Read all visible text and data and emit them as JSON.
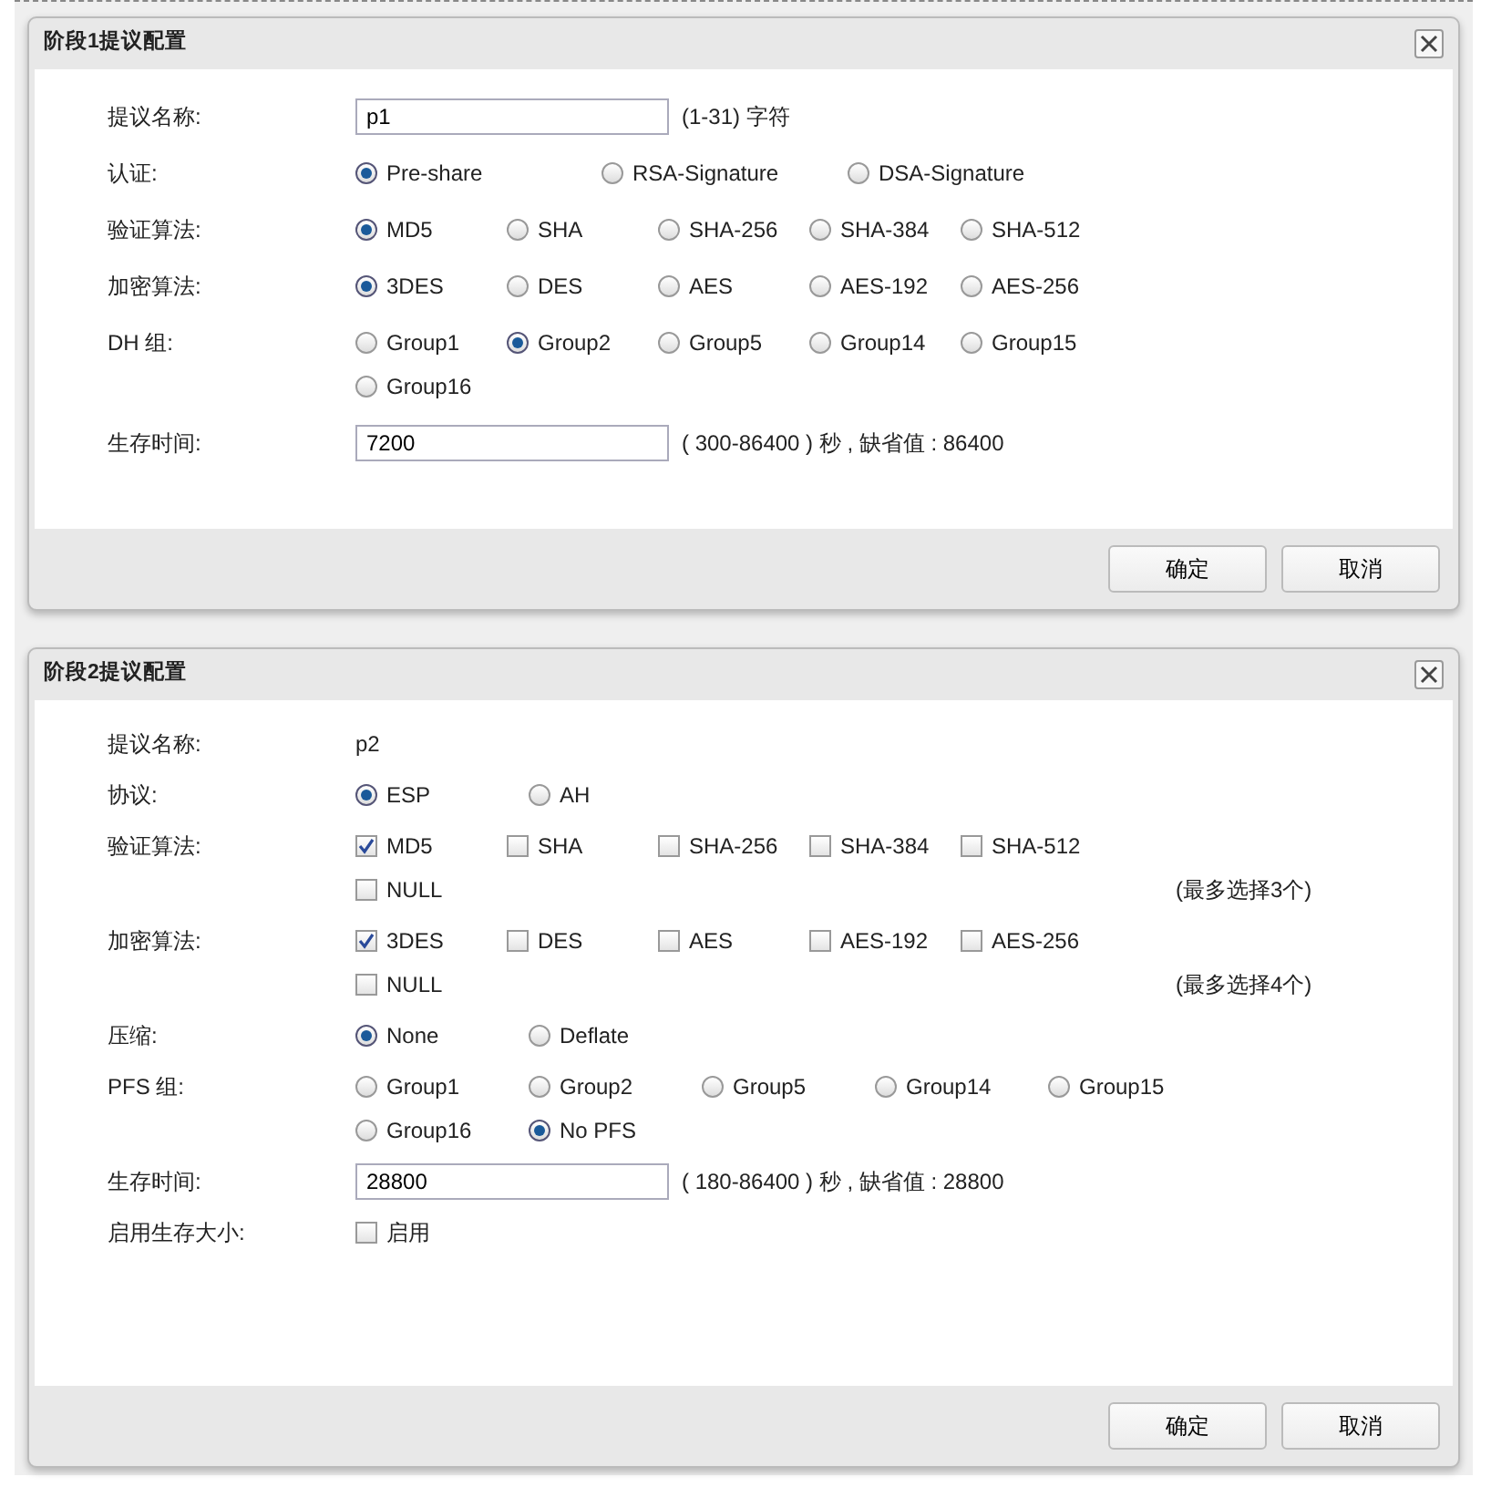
{
  "dialogs": [
    {
      "title": "阶段1提议配置",
      "rows": [
        {
          "kind": "input",
          "label": "提议名称:",
          "value": "p1",
          "hint": "(1-31) 字符"
        },
        {
          "kind": "radio",
          "label": "认证:",
          "options": [
            {
              "label": "Pre-share",
              "selected": true
            },
            {
              "label": "RSA-Signature",
              "selected": false
            },
            {
              "label": "DSA-Signature",
              "selected": false
            }
          ]
        },
        {
          "kind": "radio",
          "label": "验证算法:",
          "options": [
            {
              "label": "MD5",
              "selected": true
            },
            {
              "label": "SHA",
              "selected": false
            },
            {
              "label": "SHA-256",
              "selected": false
            },
            {
              "label": "SHA-384",
              "selected": false
            },
            {
              "label": "SHA-512",
              "selected": false
            }
          ]
        },
        {
          "kind": "radio",
          "label": "加密算法:",
          "options": [
            {
              "label": "3DES",
              "selected": true
            },
            {
              "label": "DES",
              "selected": false
            },
            {
              "label": "AES",
              "selected": false
            },
            {
              "label": "AES-192",
              "selected": false
            },
            {
              "label": "AES-256",
              "selected": false
            }
          ]
        },
        {
          "kind": "radio",
          "label": "DH 组:",
          "options": [
            {
              "label": "Group1",
              "selected": false
            },
            {
              "label": "Group2",
              "selected": true
            },
            {
              "label": "Group5",
              "selected": false
            },
            {
              "label": "Group14",
              "selected": false
            },
            {
              "label": "Group15",
              "selected": false
            },
            {
              "label": "Group16",
              "selected": false
            }
          ]
        },
        {
          "kind": "input",
          "label": "生存时间:",
          "value": "7200",
          "hint": "( 300-86400 ) 秒 , 缺省值 : 86400"
        }
      ],
      "buttons": [
        "确定",
        "取消"
      ]
    },
    {
      "title": "阶段2提议配置",
      "rows": [
        {
          "kind": "text",
          "label": "提议名称:",
          "value": "p2"
        },
        {
          "kind": "radio",
          "label": "协议:",
          "options": [
            {
              "label": "ESP",
              "selected": true
            },
            {
              "label": "AH",
              "selected": false
            }
          ]
        },
        {
          "kind": "checkbox",
          "label": "验证算法:",
          "options": [
            {
              "label": "MD5",
              "checked": true
            },
            {
              "label": "SHA",
              "checked": false
            },
            {
              "label": "SHA-256",
              "checked": false
            },
            {
              "label": "SHA-384",
              "checked": false
            },
            {
              "label": "SHA-512",
              "checked": false
            },
            {
              "label": "NULL",
              "checked": false
            }
          ],
          "note": "(最多选择3个)"
        },
        {
          "kind": "checkbox",
          "label": "加密算法:",
          "options": [
            {
              "label": "3DES",
              "checked": true
            },
            {
              "label": "DES",
              "checked": false
            },
            {
              "label": "AES",
              "checked": false
            },
            {
              "label": "AES-192",
              "checked": false
            },
            {
              "label": "AES-256",
              "checked": false
            },
            {
              "label": "NULL",
              "checked": false
            }
          ],
          "note": "(最多选择4个)"
        },
        {
          "kind": "radio",
          "label": "压缩:",
          "options": [
            {
              "label": "None",
              "selected": true
            },
            {
              "label": "Deflate",
              "selected": false
            }
          ]
        },
        {
          "kind": "radio",
          "label": "PFS 组:",
          "options": [
            {
              "label": "Group1",
              "selected": false
            },
            {
              "label": "Group2",
              "selected": false
            },
            {
              "label": "Group5",
              "selected": false
            },
            {
              "label": "Group14",
              "selected": false
            },
            {
              "label": "Group15",
              "selected": false
            },
            {
              "label": "Group16",
              "selected": false
            },
            {
              "label": "No PFS",
              "selected": true
            }
          ]
        },
        {
          "kind": "input",
          "label": "生存时间:",
          "value": "28800",
          "hint": "( 180-86400 ) 秒 , 缺省值 : 28800"
        },
        {
          "kind": "checkbox",
          "label": "启用生存大小:",
          "options": [
            {
              "label": "启用",
              "checked": false
            }
          ]
        }
      ],
      "buttons": [
        "确定",
        "取消"
      ]
    }
  ]
}
